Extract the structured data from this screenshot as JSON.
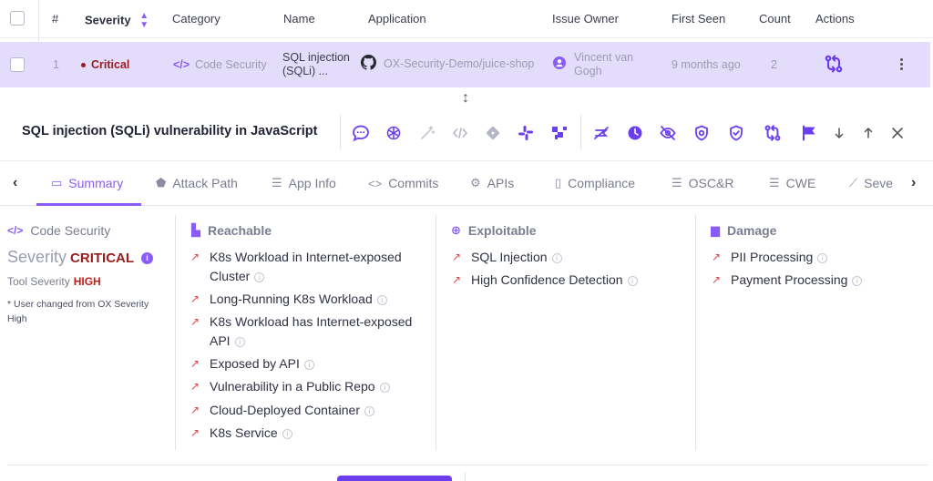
{
  "table": {
    "headers": {
      "index": "#",
      "severity": "Severity",
      "category": "Category",
      "name": "Name",
      "application": "Application",
      "owner": "Issue Owner",
      "first_seen": "First Seen",
      "count": "Count",
      "actions": "Actions"
    },
    "row": {
      "index": "1",
      "severity": "Critical",
      "category": "Code Security",
      "name_line1": "SQL injection",
      "name_line2": "(SQLi) ...",
      "application": "OX-Security-Demo/juice-shop",
      "owner_line1": "Vincent van",
      "owner_line2": "Gogh",
      "first_seen": "9 months ago",
      "count": "2"
    }
  },
  "panel": {
    "title": "SQL injection (SQLi) vulnerability in JavaScript",
    "toolbar_icons": [
      "comment-icon",
      "openai-icon",
      "magic-wand-icon",
      "code-icon",
      "git-icon",
      "slack-icon",
      "jira-icon",
      "no-ticket-icon",
      "clock-icon",
      "eye-slash-icon",
      "target-icon",
      "shield-icon",
      "pull-request-icon",
      "flag-icon",
      "arrow-down-icon",
      "arrow-up-icon",
      "close-icon"
    ]
  },
  "tabs": [
    {
      "label": "Summary",
      "icon": "summary-icon"
    },
    {
      "label": "Attack Path",
      "icon": "attack-path-icon"
    },
    {
      "label": "App Info",
      "icon": "list-icon"
    },
    {
      "label": "Commits",
      "icon": "code-icon"
    },
    {
      "label": "APIs",
      "icon": "api-icon"
    },
    {
      "label": "Compliance",
      "icon": "clipboard-icon"
    },
    {
      "label": "OSC&R",
      "icon": "list-icon"
    },
    {
      "label": "CWE",
      "icon": "list-icon"
    },
    {
      "label": "Seve",
      "icon": "trend-icon"
    }
  ],
  "summary": {
    "category": "Code Security",
    "severity_label": "Severity",
    "severity_value": "CRITICAL",
    "tool_severity_label": "Tool Severity",
    "tool_severity_value": "HIGH",
    "note_line1": "* User changed from OX Severity",
    "note_line2": "High"
  },
  "reachable": {
    "title": "Reachable",
    "items": [
      {
        "line1": "K8s Workload in Internet-exposed",
        "line2": "Cluster"
      },
      {
        "line1": "Long-Running K8s Workload",
        "line2": ""
      },
      {
        "line1": "K8s Workload has Internet-exposed",
        "line2": "API"
      },
      {
        "line1": "Exposed by API",
        "line2": ""
      },
      {
        "line1": "Vulnerability in a Public Repo",
        "line2": ""
      },
      {
        "line1": "Cloud-Deployed Container",
        "line2": ""
      },
      {
        "line1": "K8s Service",
        "line2": ""
      }
    ]
  },
  "exploitable": {
    "title": "Exploitable",
    "items": [
      "SQL Injection",
      "High Confidence Detection"
    ]
  },
  "damage": {
    "title": "Damage",
    "items": [
      "PII Processing",
      "Payment Processing"
    ]
  },
  "colors": {
    "accent": "#8a5cf6",
    "selected_row": "#e4dcfb",
    "critical": "#9b1c1c",
    "high": "#c0201b",
    "arrow": "#e0454b"
  }
}
